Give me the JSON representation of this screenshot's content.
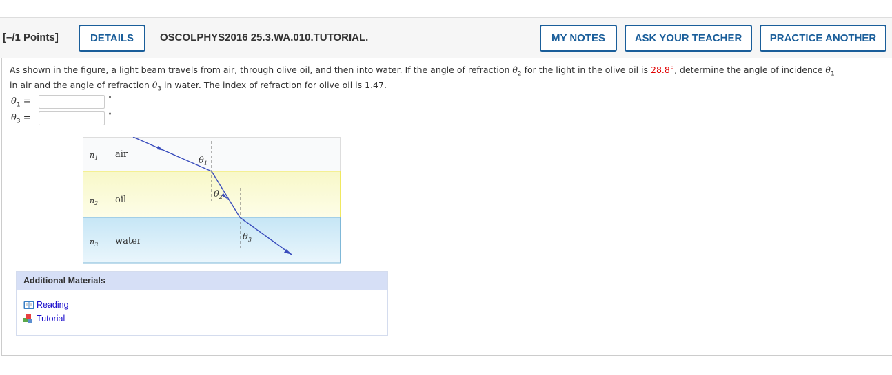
{
  "header": {
    "points": "[–/1 Points]",
    "details": "DETAILS",
    "question_id": "OSCOLPHYS2016 25.3.WA.010.TUTORIAL.",
    "my_notes": "MY NOTES",
    "ask_teacher": "ASK YOUR TEACHER",
    "practice_another": "PRACTICE ANOTHER"
  },
  "question": {
    "line1_a": "As shown in the figure, a light beam travels from air, through olive oil, and then into water. If the angle of refraction ",
    "theta2": "θ",
    "theta2_sub": "2",
    "line1_b": " for the light in the olive oil is ",
    "value": "28.8°",
    "line1_c": ", determine the angle of incidence ",
    "theta1": "θ",
    "theta1_sub": "1",
    "line2_a": "in air and the angle of refraction ",
    "theta3": "θ",
    "theta3_sub": "3",
    "line2_b": " in water. The index of refraction for olive oil is 1.47."
  },
  "answers": [
    {
      "label": "θ",
      "sub": "1",
      "eq": " =",
      "value": "",
      "unit": "°"
    },
    {
      "label": "θ",
      "sub": "3",
      "eq": " =",
      "value": "",
      "unit": "°"
    }
  ],
  "figure": {
    "layers": [
      {
        "n": "n",
        "sub": "1",
        "name": "air"
      },
      {
        "n": "n",
        "sub": "2",
        "name": "oil"
      },
      {
        "n": "n",
        "sub": "3",
        "name": "water"
      }
    ],
    "angles": [
      "θ1",
      "θ2",
      "θ3"
    ],
    "beam_color": "#3a4dbd"
  },
  "additional": {
    "title": "Additional Materials",
    "links": [
      {
        "label": "Reading",
        "icon": "book-icon"
      },
      {
        "label": "Tutorial",
        "icon": "cubes-icon"
      }
    ]
  }
}
